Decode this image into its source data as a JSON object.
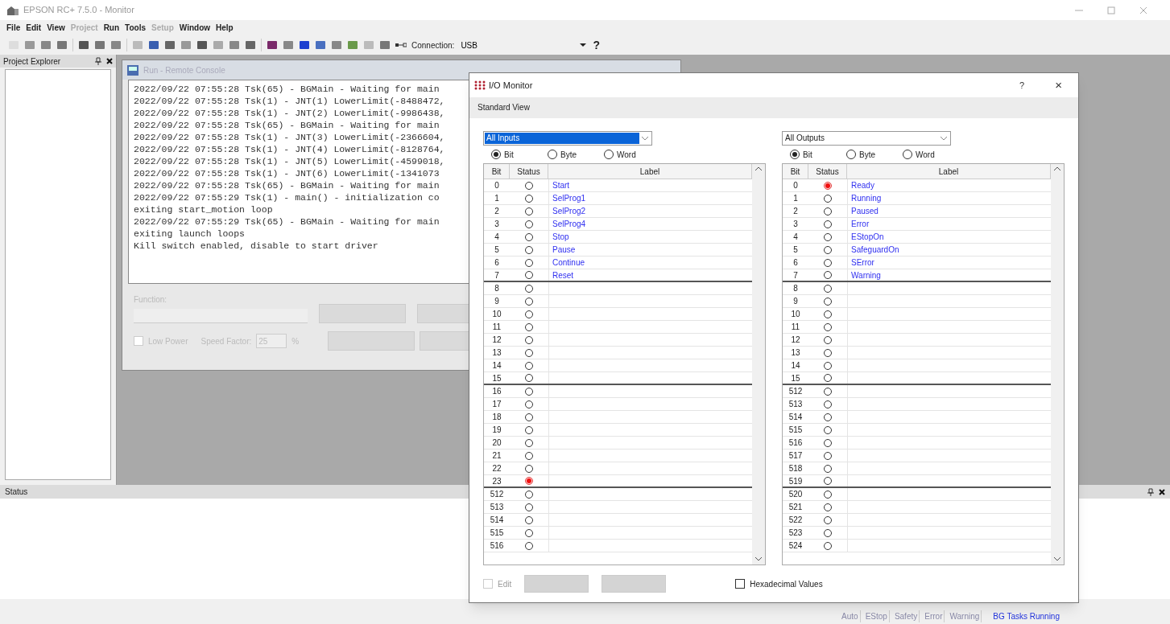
{
  "window": {
    "title": "EPSON RC+ 7.5.0 - Monitor"
  },
  "menu": [
    {
      "label": "File",
      "disabled": false
    },
    {
      "label": "Edit",
      "disabled": false
    },
    {
      "label": "View",
      "disabled": false
    },
    {
      "label": "Project",
      "disabled": true
    },
    {
      "label": "Run",
      "disabled": false
    },
    {
      "label": "Tools",
      "disabled": false
    },
    {
      "label": "Setup",
      "disabled": true
    },
    {
      "label": "Window",
      "disabled": false
    },
    {
      "label": "Help",
      "disabled": false
    }
  ],
  "toolbar": {
    "connection_label": "Connection:",
    "connection_value": "USB",
    "help": "?"
  },
  "project_explorer": {
    "title": "Project Explorer"
  },
  "run_window": {
    "title": "Run - Remote Console",
    "console_lines": [
      "2022/09/22 07:55:28 Tsk(65) - BGMain - Waiting for main",
      "2022/09/22 07:55:28 Tsk(1) - JNT(1) LowerLimit(-8488472,",
      "2022/09/22 07:55:28 Tsk(1) - JNT(2) LowerLimit(-9986438,",
      "2022/09/22 07:55:28 Tsk(65) - BGMain - Waiting for main",
      "2022/09/22 07:55:28 Tsk(1) - JNT(3) LowerLimit(-2366604,",
      "2022/09/22 07:55:28 Tsk(1) - JNT(4) LowerLimit(-8128764,",
      "2022/09/22 07:55:28 Tsk(1) - JNT(5) LowerLimit(-4599018,",
      "2022/09/22 07:55:28 Tsk(1) - JNT(6) LowerLimit(-1341073",
      "2022/09/22 07:55:28 Tsk(65) - BGMain - Waiting for main",
      "2022/09/22 07:55:29 Tsk(1) - main() - initialization co",
      "exiting start_motion loop",
      "2022/09/22 07:55:29 Tsk(65) - BGMain - Waiting for main",
      "exiting launch loops",
      "Kill switch enabled, disable to start driver"
    ],
    "function_label": "Function:",
    "low_power": {
      "label": "Low Power",
      "checked": false
    },
    "speed_factor_label": "Speed Factor:",
    "speed_factor": "25",
    "percent": "%"
  },
  "io_monitor": {
    "title": "I/O Monitor",
    "help": "?",
    "close": "×",
    "tab": "Standard View",
    "hexadecimal": {
      "label": "Hexadecimal Values",
      "checked": false
    },
    "edit": {
      "label": "Edit",
      "checked": false
    },
    "panels": [
      {
        "dropdown": "All Inputs",
        "dropdown_selected": true,
        "modes": [
          {
            "label": "Bit",
            "selected": true
          },
          {
            "label": "Byte",
            "selected": false
          },
          {
            "label": "Word",
            "selected": false
          }
        ],
        "columns": [
          "Bit",
          "Status",
          "Label"
        ],
        "rows": [
          {
            "bit": "0",
            "on": false,
            "label": "Start"
          },
          {
            "bit": "1",
            "on": false,
            "label": "SelProg1"
          },
          {
            "bit": "2",
            "on": false,
            "label": "SelProg2"
          },
          {
            "bit": "3",
            "on": false,
            "label": "SelProg4"
          },
          {
            "bit": "4",
            "on": false,
            "label": "Stop"
          },
          {
            "bit": "5",
            "on": false,
            "label": "Pause"
          },
          {
            "bit": "6",
            "on": false,
            "label": "Continue"
          },
          {
            "bit": "7",
            "on": false,
            "label": "Reset"
          },
          {
            "bit": "8",
            "on": false
          },
          {
            "bit": "9",
            "on": false
          },
          {
            "bit": "10",
            "on": false
          },
          {
            "bit": "11",
            "on": false
          },
          {
            "bit": "12",
            "on": false
          },
          {
            "bit": "13",
            "on": false
          },
          {
            "bit": "14",
            "on": false
          },
          {
            "bit": "15",
            "on": false
          },
          {
            "bit": "16",
            "on": false
          },
          {
            "bit": "17",
            "on": false
          },
          {
            "bit": "18",
            "on": false
          },
          {
            "bit": "19",
            "on": false
          },
          {
            "bit": "20",
            "on": false
          },
          {
            "bit": "21",
            "on": false
          },
          {
            "bit": "22",
            "on": false
          },
          {
            "bit": "23",
            "on": true
          },
          {
            "bit": "512",
            "on": false
          },
          {
            "bit": "513",
            "on": false
          },
          {
            "bit": "514",
            "on": false
          },
          {
            "bit": "515",
            "on": false
          },
          {
            "bit": "516",
            "on": false
          }
        ]
      },
      {
        "dropdown": "All Outputs",
        "dropdown_selected": false,
        "modes": [
          {
            "label": "Bit",
            "selected": true
          },
          {
            "label": "Byte",
            "selected": false
          },
          {
            "label": "Word",
            "selected": false
          }
        ],
        "columns": [
          "Bit",
          "Status",
          "Label"
        ],
        "rows": [
          {
            "bit": "0",
            "on": true,
            "label": "Ready"
          },
          {
            "bit": "1",
            "on": false,
            "label": "Running"
          },
          {
            "bit": "2",
            "on": false,
            "label": "Paused"
          },
          {
            "bit": "3",
            "on": false,
            "label": "Error"
          },
          {
            "bit": "4",
            "on": false,
            "label": "EStopOn"
          },
          {
            "bit": "5",
            "on": false,
            "label": "SafeguardOn"
          },
          {
            "bit": "6",
            "on": false,
            "label": "SError"
          },
          {
            "bit": "7",
            "on": false,
            "label": "Warning"
          },
          {
            "bit": "8",
            "on": false
          },
          {
            "bit": "9",
            "on": false
          },
          {
            "bit": "10",
            "on": false
          },
          {
            "bit": "11",
            "on": false
          },
          {
            "bit": "12",
            "on": false
          },
          {
            "bit": "13",
            "on": false
          },
          {
            "bit": "14",
            "on": false
          },
          {
            "bit": "15",
            "on": false
          },
          {
            "bit": "512",
            "on": false
          },
          {
            "bit": "513",
            "on": false
          },
          {
            "bit": "514",
            "on": false
          },
          {
            "bit": "515",
            "on": false
          },
          {
            "bit": "516",
            "on": false
          },
          {
            "bit": "517",
            "on": false
          },
          {
            "bit": "518",
            "on": false
          },
          {
            "bit": "519",
            "on": false
          },
          {
            "bit": "520",
            "on": false
          },
          {
            "bit": "521",
            "on": false
          },
          {
            "bit": "522",
            "on": false
          },
          {
            "bit": "523",
            "on": false
          },
          {
            "bit": "524",
            "on": false
          }
        ]
      }
    ]
  },
  "status_panel": {
    "title": "Status"
  },
  "status_bar": [
    {
      "label": "Auto",
      "active": false
    },
    {
      "label": "EStop",
      "active": false
    },
    {
      "label": "Safety",
      "active": false
    },
    {
      "label": "Error",
      "active": false
    },
    {
      "label": "Warning",
      "active": false
    },
    {
      "label": "BG Tasks Running",
      "active": true
    }
  ]
}
